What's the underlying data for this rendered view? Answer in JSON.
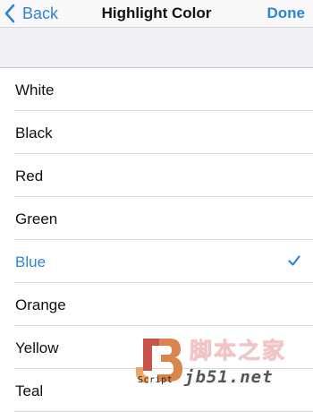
{
  "navbar": {
    "back_label": "Back",
    "title": "Highlight Color",
    "done_label": "Done"
  },
  "accent_color": "#2f84d6",
  "colors": {
    "items": [
      {
        "label": "White"
      },
      {
        "label": "Black"
      },
      {
        "label": "Red"
      },
      {
        "label": "Green"
      },
      {
        "label": "Blue",
        "selected": true
      },
      {
        "label": "Orange"
      },
      {
        "label": "Yellow"
      },
      {
        "label": "Teal"
      }
    ]
  },
  "watermark": {
    "script_label": "Script",
    "cn_text": "脚本之家",
    "domain_text": "jb51.net"
  }
}
